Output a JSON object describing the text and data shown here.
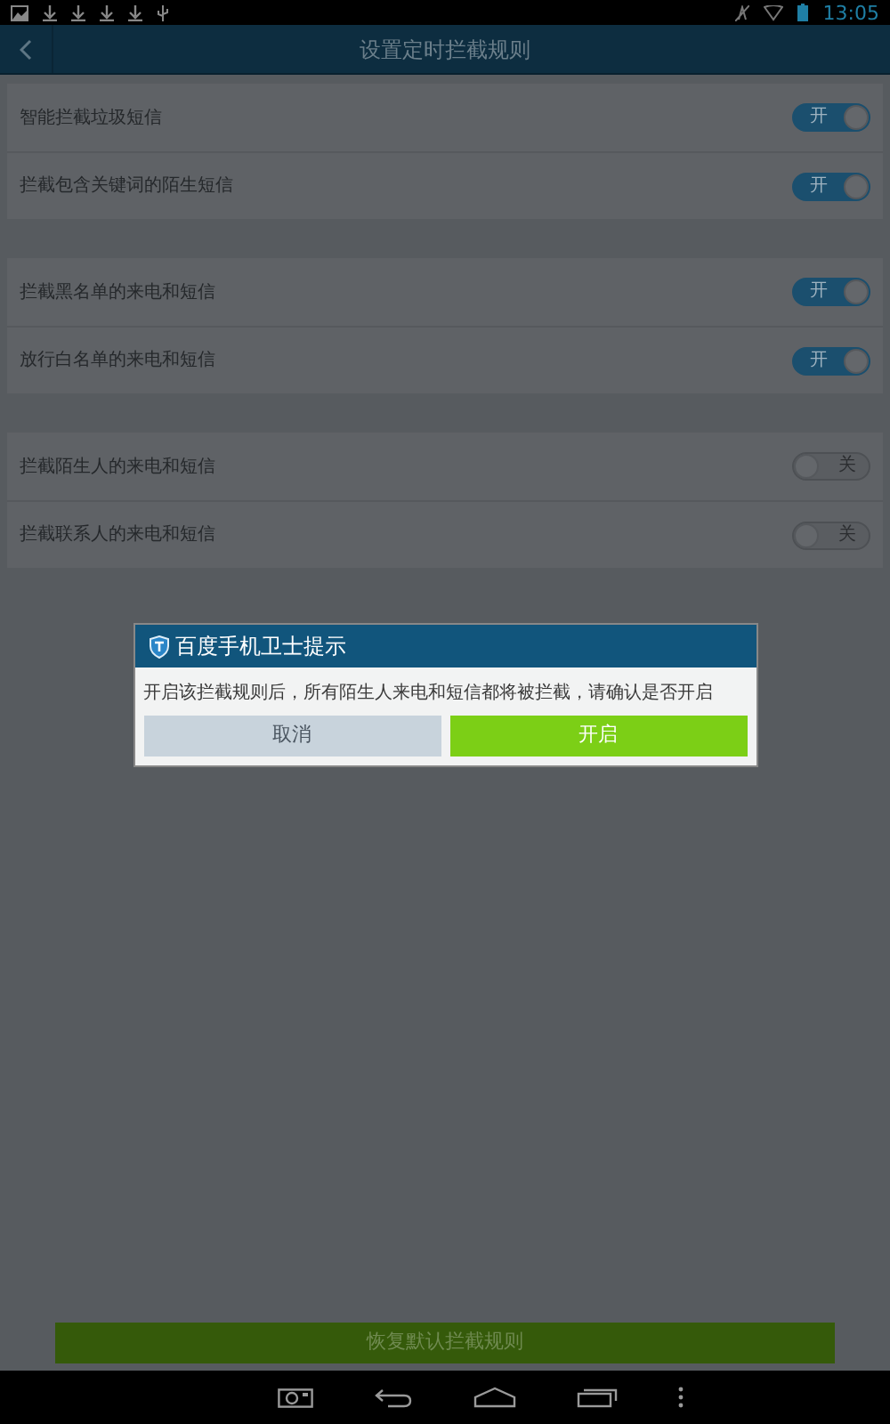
{
  "status_bar": {
    "time": "13:05"
  },
  "header": {
    "title": "设置定时拦截规则"
  },
  "sections": [
    {
      "rules": [
        {
          "label": "智能拦截垃圾短信",
          "on": true,
          "toggle_text": "开"
        },
        {
          "label": "拦截包含关键词的陌生短信",
          "on": true,
          "toggle_text": "开"
        }
      ]
    },
    {
      "rules": [
        {
          "label": "拦截黑名单的来电和短信",
          "on": true,
          "toggle_text": "开"
        },
        {
          "label": "放行白名单的来电和短信",
          "on": true,
          "toggle_text": "开"
        }
      ]
    },
    {
      "rules": [
        {
          "label": "拦截陌生人的来电和短信",
          "on": false,
          "toggle_text": "关"
        },
        {
          "label": "拦截联系人的来电和短信",
          "on": false,
          "toggle_text": "关"
        }
      ]
    }
  ],
  "dialog": {
    "title": "百度手机卫士提示",
    "message": "开启该拦截规则后，所有陌生人来电和短信都将被拦截，请确认是否开启",
    "buttons": [
      {
        "label": "取消",
        "kind": "cancel"
      },
      {
        "label": "开启",
        "kind": "confirm"
      }
    ]
  },
  "restore_button": {
    "label": "恢复默认拦截规则"
  }
}
